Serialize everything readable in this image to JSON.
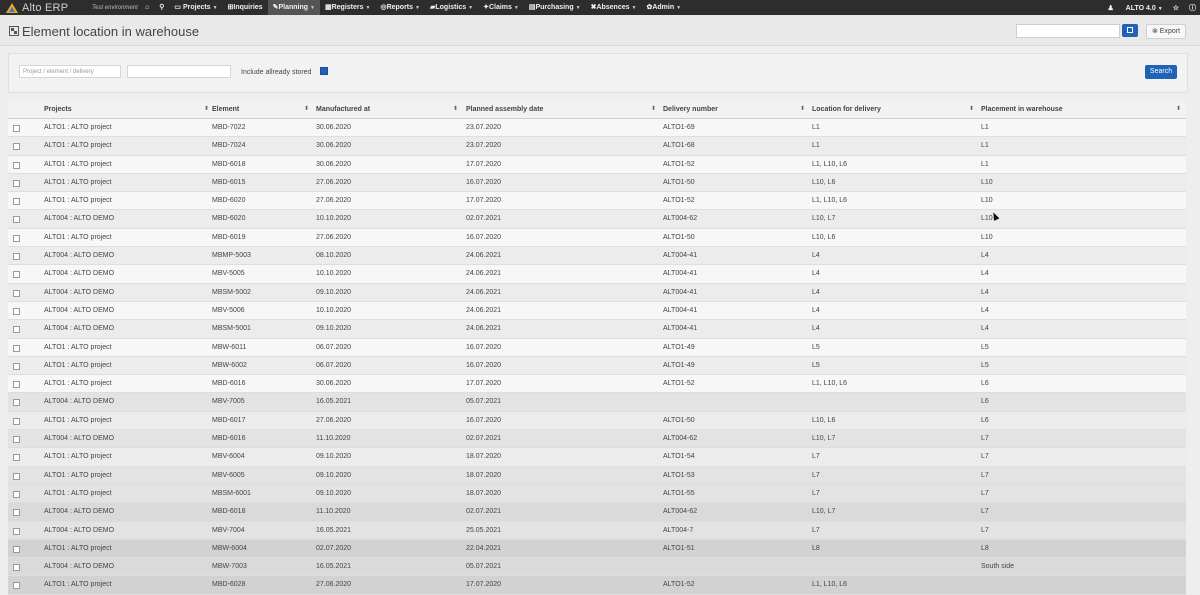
{
  "navbar": {
    "logo_text": "Alto ERP",
    "env_label": "Test environment",
    "items": [
      {
        "icon": "home-icon",
        "label": ""
      },
      {
        "icon": "search-icon",
        "label": ""
      },
      {
        "icon": "folder-icon",
        "label": "Projects",
        "caret": "▼"
      },
      {
        "icon": "cart-icon",
        "label": "Inquiries",
        "caret": ""
      },
      {
        "icon": "wrench-icon",
        "label": "Planning",
        "caret": "▼"
      },
      {
        "icon": "table-icon",
        "label": "Registers",
        "caret": "▼"
      },
      {
        "icon": "gear-icon",
        "label": "Reports",
        "caret": "▼"
      },
      {
        "icon": "truck-icon",
        "label": "Logistics",
        "caret": "▼"
      },
      {
        "icon": "flame-icon",
        "label": "Claims",
        "caret": "▼"
      },
      {
        "icon": "doc-icon",
        "label": "Purchasing",
        "caret": "▼"
      },
      {
        "icon": "x-icon",
        "label": "Absences",
        "caret": "▼"
      },
      {
        "icon": "cog-icon",
        "label": "Admin",
        "caret": "▼"
      }
    ],
    "user_label": "ALTO 4.0",
    "user_caret": "▼"
  },
  "page": {
    "title": "Element location in warehouse",
    "export_label": "Export"
  },
  "filters": {
    "input1_placeholder": "Project / element / delivery",
    "include_label": "Include allready stored",
    "include_checked": true,
    "search_label": "Search"
  },
  "table": {
    "columns": [
      "Projects",
      "Element",
      "Manufactured at",
      "Planned assembly date",
      "Delivery number",
      "Location for delivery",
      "Placement in warehouse"
    ],
    "rows": [
      [
        "ALTO1 : ALTO project",
        "MBD-7022",
        "30.06.2020",
        "23.07.2020",
        "ALTO1-69",
        "L1",
        "L1"
      ],
      [
        "ALTO1 : ALTO project",
        "MBD-7024",
        "30.06.2020",
        "23.07.2020",
        "ALTO1-68",
        "L1",
        "L1"
      ],
      [
        "ALTO1 : ALTO project",
        "MBD-6018",
        "30.06.2020",
        "17.07.2020",
        "ALTO1-52",
        "L1, L10, L6",
        "L1"
      ],
      [
        "ALTO1 : ALTO project",
        "MBD-6015",
        "27.06.2020",
        "16.07.2020",
        "ALTO1-50",
        "L10, L6",
        "L10"
      ],
      [
        "ALTO1 : ALTO project",
        "MBD-6020",
        "27.06.2020",
        "17.07.2020",
        "ALTO1-52",
        "L1, L10, L6",
        "L10"
      ],
      [
        "ALT004 : ALTO DEMO",
        "MBD-6020",
        "10.10.2020",
        "02.07.2021",
        "ALT004-62",
        "L10, L7",
        "L10"
      ],
      [
        "ALTO1 : ALTO project",
        "MBD-6019",
        "27.06.2020",
        "16.07.2020",
        "ALTO1-50",
        "L10, L6",
        "L10"
      ],
      [
        "ALT004 : ALTO DEMO",
        "MBMP-5003",
        "08.10.2020",
        "24.06.2021",
        "ALT004-41",
        "L4",
        "L4"
      ],
      [
        "ALT004 : ALTO DEMO",
        "MBV-5005",
        "10.10.2020",
        "24.06.2021",
        "ALT004-41",
        "L4",
        "L4"
      ],
      [
        "ALT004 : ALTO DEMO",
        "MBSM-5002",
        "09.10.2020",
        "24.06.2021",
        "ALT004-41",
        "L4",
        "L4"
      ],
      [
        "ALT004 : ALTO DEMO",
        "MBV-5006",
        "10.10.2020",
        "24.06.2021",
        "ALT004-41",
        "L4",
        "L4"
      ],
      [
        "ALT004 : ALTO DEMO",
        "MBSM-5001",
        "09.10.2020",
        "24.06.2021",
        "ALT004-41",
        "L4",
        "L4"
      ],
      [
        "ALTO1 : ALTO project",
        "MBW-6011",
        "06.07.2020",
        "16.07.2020",
        "ALTO1-49",
        "L5",
        "L5"
      ],
      [
        "ALTO1 : ALTO project",
        "MBW-6002",
        "06.07.2020",
        "16.07.2020",
        "ALTO1-49",
        "L5",
        "L5"
      ],
      [
        "ALTO1 : ALTO project",
        "MBD-6016",
        "30.06.2020",
        "17.07.2020",
        "ALTO1-52",
        "L1, L10, L6",
        "L6"
      ],
      [
        "ALT004 : ALTO DEMO",
        "MBV-7005",
        "16.05.2021",
        "05.07.2021",
        "",
        "",
        "L6"
      ],
      [
        "ALTO1 : ALTO project",
        "MBD-6017",
        "27.06.2020",
        "16.07.2020",
        "ALTO1-50",
        "L10, L6",
        "L6"
      ],
      [
        "ALT004 : ALTO DEMO",
        "MBD-6016",
        "11.10.2020",
        "02.07.2021",
        "ALT004-62",
        "L10, L7",
        "L7"
      ],
      [
        "ALTO1 : ALTO project",
        "MBV-6004",
        "09.10.2020",
        "18.07.2020",
        "ALTO1-54",
        "L7",
        "L7"
      ],
      [
        "ALTO1 : ALTO project",
        "MBV-6005",
        "09.10.2020",
        "18.07.2020",
        "ALTO1-53",
        "L7",
        "L7"
      ],
      [
        "ALTO1 : ALTO project",
        "MBSM-6001",
        "09.10.2020",
        "18.07.2020",
        "ALTO1-55",
        "L7",
        "L7"
      ],
      [
        "ALT004 : ALTO DEMO",
        "MBD-6018",
        "11.10.2020",
        "02.07.2021",
        "ALT004-62",
        "L10, L7",
        "L7"
      ],
      [
        "ALT004 : ALTO DEMO",
        "MBV-7004",
        "16.05.2021",
        "25.05.2021",
        "ALT004-7",
        "L7",
        "L7"
      ],
      [
        "ALTO1 : ALTO project",
        "MBW-6004",
        "02.07.2020",
        "22.04.2021",
        "ALTO1-51",
        "L8",
        "L8"
      ],
      [
        "ALT004 : ALTO DEMO",
        "MBW-7003",
        "16.05.2021",
        "05.07.2021",
        "",
        "",
        "South side"
      ],
      [
        "ALTO1 : ALTO project",
        "MBD-6028",
        "27.06.2020",
        "17.07.2020",
        "ALTO1-52",
        "L1, L10, L6",
        ""
      ]
    ]
  }
}
